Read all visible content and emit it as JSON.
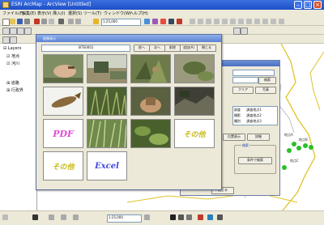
{
  "window": {
    "title": "ESRI ArcMap - ArcView [Untitled]"
  },
  "menu": [
    "ファイル(F)",
    "編集(E)",
    "表示(V)",
    "挿入(I)",
    "選択(S)",
    "ツール(T)",
    "ウィンドウ(W)",
    "ヘルプ(H)"
  ],
  "toolbar": {
    "scale_value": "1:25,000"
  },
  "sidebar": {
    "items": [
      {
        "label": "Layers"
      },
      {
        "label": "地点"
      },
      {
        "label": "河川"
      },
      {
        "label": "道路"
      },
      {
        "label": "行政界"
      }
    ]
  },
  "photo_dialog": {
    "title": "画像表示",
    "header_label": "SITE0001",
    "nav_buttons": [
      "前へ",
      "次へ",
      "削除",
      "追加(A)",
      "閉じる"
    ],
    "document_tiles": [
      {
        "label": "PDF",
        "color": "#e34bd6"
      },
      {
        "label": "その他",
        "color": "#c8bd18"
      },
      {
        "label": "その他",
        "color": "#c8bd18"
      },
      {
        "label": "Excel",
        "color": "#4149d8"
      }
    ]
  },
  "second_form": {
    "buttons": [
      "検索",
      "クリア",
      "写真",
      "位置表示",
      "詳細",
      "閉じる"
    ],
    "table_rows": [
      [
        "調査",
        "調査地点1"
      ],
      [
        "撮影",
        "調査地点2"
      ],
      [
        "種別",
        "調査地点3"
      ]
    ],
    "search_group": {
      "title": "検索",
      "button": "条件で検索"
    }
  },
  "map": {
    "point_color": "#2bbf2b",
    "river_color": "#e0c227",
    "labels": [
      "地点A",
      "地点B",
      "地点C"
    ]
  },
  "status": {
    "scale_value": "1:25,000"
  }
}
